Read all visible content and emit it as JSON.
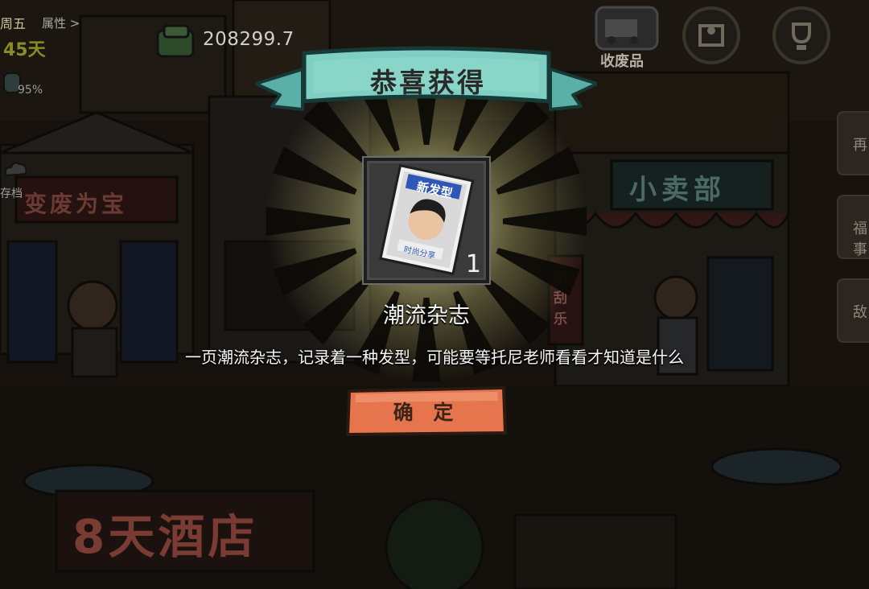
{
  "hud": {
    "coins": "208299.7",
    "day_label": "周五",
    "attributes_label": "属性 >",
    "days_label": "45天",
    "energy_percent": "95%",
    "save_label": "存档",
    "recycle_label": "收废品"
  },
  "scene": {
    "left_shop_sign": "变废为宝",
    "shop_sign": "小卖部",
    "hotel_sign": "8天酒店",
    "lottery_sign": "刮刮乐",
    "side_tabs": [
      "再",
      "福事",
      "敌"
    ]
  },
  "dialog": {
    "title": "恭喜获得",
    "item_name": "潮流杂志",
    "item_count": "1",
    "item_description": "一页潮流杂志，记录着一种发型，可能要等托尼老师看看才知道是什么",
    "confirm_label": "确 定",
    "magazine_cover_text": "新发型",
    "magazine_caption": "时尚分享"
  },
  "colors": {
    "ribbon": "#6fc2b8",
    "ribbon_dark": "#3d8d84",
    "confirm_button": "#e6744c",
    "glow": "#e8e6a0"
  },
  "icons": [
    "coin-stack-icon",
    "energy-icon",
    "cloud-save-icon",
    "recycle-truck-icon",
    "map-icon",
    "trophy-icon"
  ]
}
